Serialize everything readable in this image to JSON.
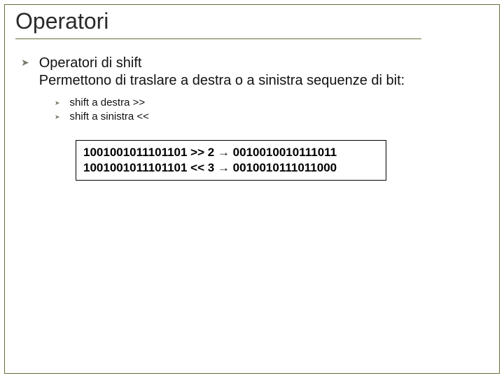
{
  "title": "Operatori",
  "lvl1": {
    "line1": "Operatori di shift",
    "line2": "Permettono di traslare a destra o a sinistra sequenze di bit:"
  },
  "lvl2": [
    {
      "text": "shift a destra >>"
    },
    {
      "text": "shift a sinistra <<"
    }
  ],
  "code": {
    "line1": "1001001011101101 >> 2 → 0010010010111011",
    "line2": "1001001011101101 << 3 → 0010010111011000"
  }
}
